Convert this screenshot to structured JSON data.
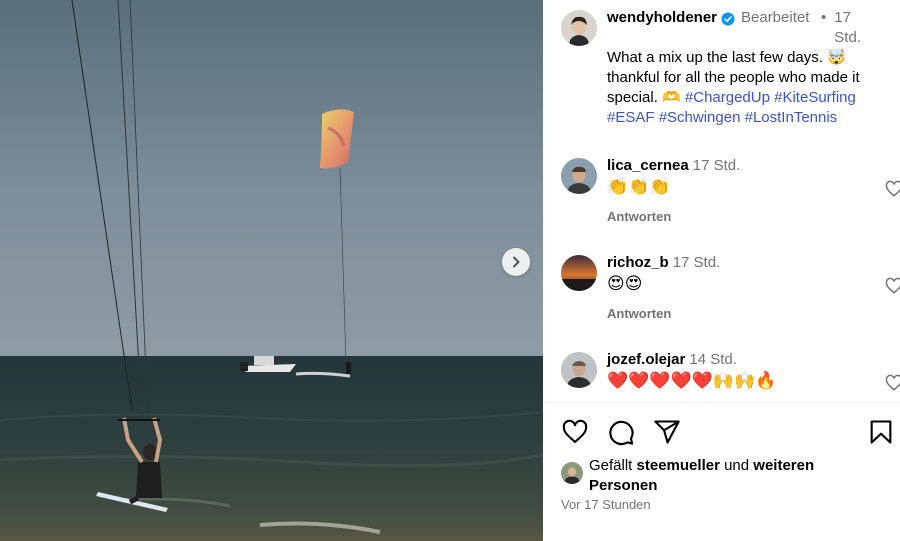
{
  "post": {
    "author": "wendyholdener",
    "edited_label": "Bearbeitet",
    "separator": "•",
    "time": "17 Std.",
    "caption_text": "What a mix up the last few days. 🤯 thankful for all the people who made it special. 🫶",
    "hashtags": [
      "#ChargedUp",
      "#KiteSurfing",
      "#ESAF",
      "#Schwingen",
      "#LostInTennis"
    ]
  },
  "comments": [
    {
      "user": "lica_cernea",
      "time": "17 Std.",
      "text": "👏👏👏",
      "reply_label": "Antworten"
    },
    {
      "user": "richoz_b",
      "time": "17 Std.",
      "text": "😍😍",
      "reply_label": "Antworten"
    },
    {
      "user": "jozef.olejar",
      "time": "14 Std.",
      "text": "❤️❤️❤️❤️❤️🙌🙌🔥"
    }
  ],
  "likes": {
    "prefix": "Gefällt",
    "user": "steemueller",
    "conjunction": "und",
    "suffix": "weiteren Personen"
  },
  "posted_ago": "Vor 17 Stunden",
  "icons": {
    "verified": "verified-badge-icon",
    "like": "heart-icon",
    "comment": "comment-bubble-icon",
    "share": "send-icon",
    "save": "bookmark-icon",
    "next": "chevron-right-icon"
  },
  "colors": {
    "link": "#3a54c7",
    "muted": "#737373",
    "verified": "#0095f6"
  }
}
